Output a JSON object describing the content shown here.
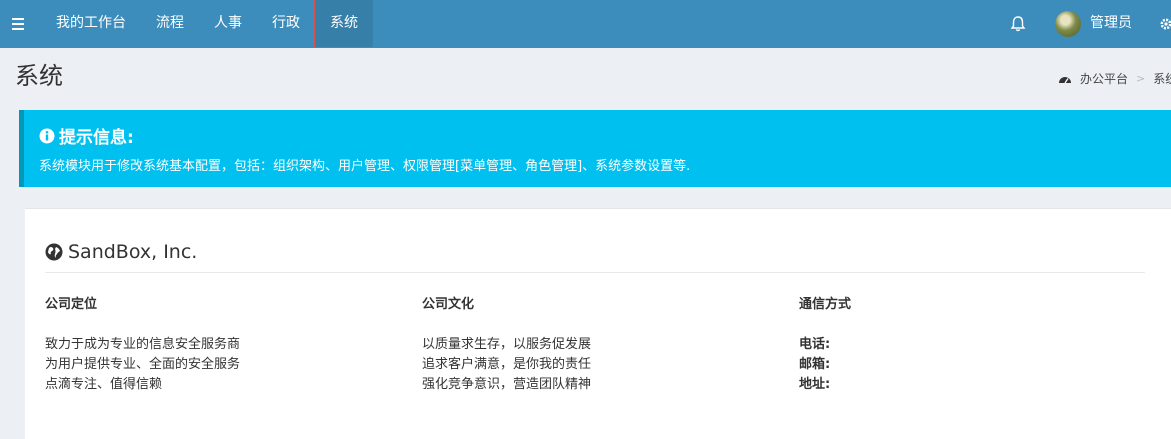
{
  "navbar": {
    "menu": [
      "我的工作台",
      "流程",
      "人事",
      "行政",
      "系统"
    ],
    "user": "管理员"
  },
  "page": {
    "title": "系统",
    "breadcrumb": [
      "办公平台",
      "系统"
    ]
  },
  "callout": {
    "title": "提示信息:",
    "text": "系统模块用于修改系统基本配置，包括：组织架构、用户管理、权限管理[菜单管理、角色管理]、系统参数设置等."
  },
  "company": {
    "name": "SandBox, Inc.",
    "columns": [
      {
        "heading": "公司定位",
        "lines": [
          "致力于成为专业的信息安全服务商",
          "为用户提供专业、全面的安全服务",
          "点滴专注、值得信赖"
        ]
      },
      {
        "heading": "公司文化",
        "lines": [
          "以质量求生存，以服务促发展",
          "追求客户满意，是你我的责任",
          "强化竞争意识，营造团队精神"
        ]
      },
      {
        "heading": "通信方式",
        "lines": [
          "电话:",
          "邮箱:",
          "地址:"
        ]
      }
    ]
  },
  "colors": {
    "navbar": "#3c8dbc",
    "callout": "#00c0ef",
    "background": "#ecf0f5",
    "active_border": "#d9534f"
  },
  "icons": [
    "menu-icon",
    "bell-icon",
    "avatar",
    "gear-icon",
    "dashboard-icon",
    "info-icon",
    "globe-icon"
  ]
}
